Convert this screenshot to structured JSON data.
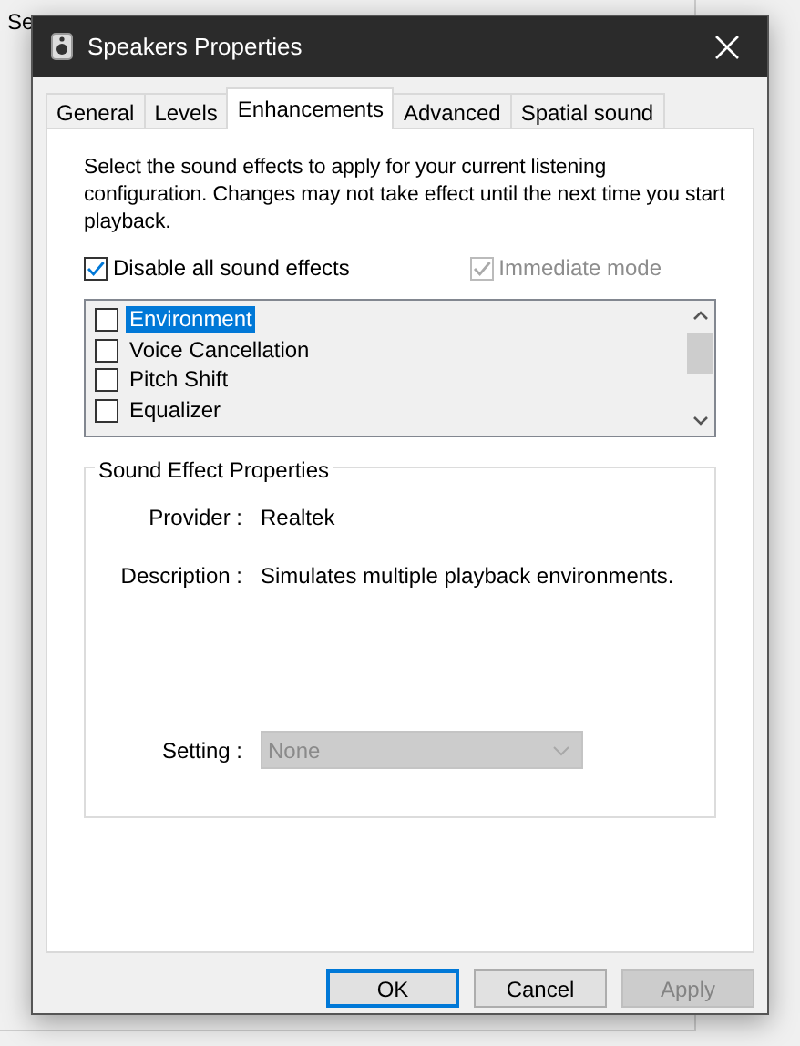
{
  "background_window": {
    "text": "Se"
  },
  "window": {
    "title": "Speakers Properties"
  },
  "tabs": [
    {
      "label": "General",
      "selected": false
    },
    {
      "label": "Levels",
      "selected": false
    },
    {
      "label": "Enhancements",
      "selected": true
    },
    {
      "label": "Advanced",
      "selected": false
    },
    {
      "label": "Spatial sound",
      "selected": false
    }
  ],
  "intro": "Select the sound effects to apply for your current listening configuration. Changes may not take effect until the next time you start playback.",
  "options": [
    {
      "label": "Disable all sound effects",
      "checked": true,
      "disabled": false
    },
    {
      "label": "Immediate mode",
      "checked": true,
      "disabled": true
    }
  ],
  "effects": [
    {
      "label": "Environment",
      "checked": false,
      "selected": true
    },
    {
      "label": "Voice Cancellation",
      "checked": false,
      "selected": false
    },
    {
      "label": "Pitch Shift",
      "checked": false,
      "selected": false
    },
    {
      "label": "Equalizer",
      "checked": false,
      "selected": false
    }
  ],
  "properties": {
    "legend": "Sound Effect Properties",
    "rows": [
      {
        "label": "Provider :",
        "value": "Realtek"
      },
      {
        "label": "Description :",
        "value": "Simulates multiple playback environments."
      }
    ],
    "setting": {
      "label": "Setting :",
      "value": "None",
      "disabled": true
    }
  },
  "buttons": [
    {
      "label": "OK",
      "kind": "default",
      "disabled": false
    },
    {
      "label": "Cancel",
      "kind": "normal",
      "disabled": false
    },
    {
      "label": "Apply",
      "kind": "normal",
      "disabled": true
    }
  ]
}
